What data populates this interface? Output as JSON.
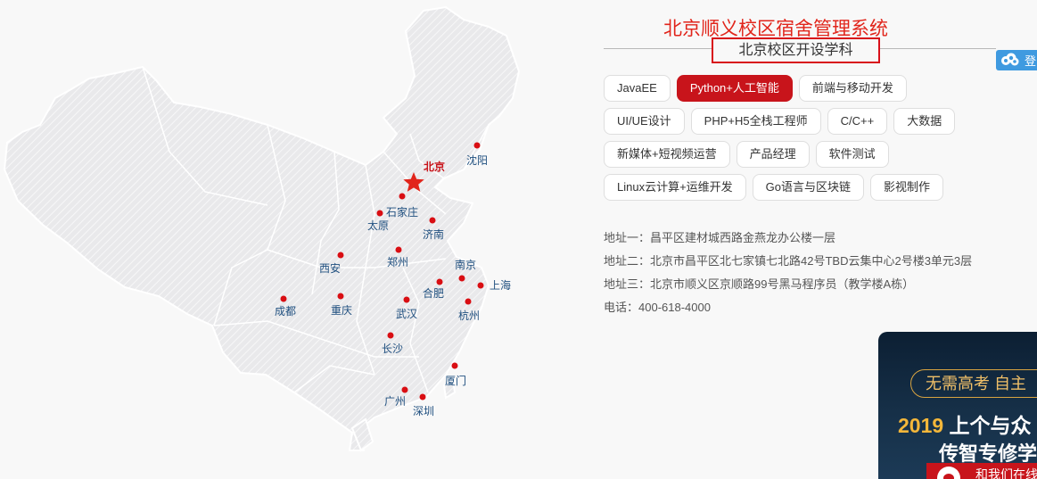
{
  "header": {
    "title": "北京顺义校区宿舍管理系统",
    "subtitle": "北京校区开设学科"
  },
  "side_widget": {
    "icon": "cloud-icon",
    "text": "登"
  },
  "subjects": {
    "rows": [
      [
        {
          "label": "JavaEE",
          "active": false
        },
        {
          "label": "Python+人工智能",
          "active": true
        },
        {
          "label": "前端与移动开发",
          "active": false
        }
      ],
      [
        {
          "label": "UI/UE设计",
          "active": false
        },
        {
          "label": "PHP+H5全栈工程师",
          "active": false
        },
        {
          "label": "C/C++",
          "active": false
        },
        {
          "label": "大数据",
          "active": false
        }
      ],
      [
        {
          "label": "新媒体+短视频运营",
          "active": false
        },
        {
          "label": "产品经理",
          "active": false
        },
        {
          "label": "软件测试",
          "active": false
        }
      ],
      [
        {
          "label": "Linux云计算+运维开发",
          "active": false
        },
        {
          "label": "Go语言与区块链",
          "active": false
        },
        {
          "label": "影视制作",
          "active": false
        }
      ]
    ]
  },
  "info": {
    "address1": "地址一：昌平区建材城西路金燕龙办公楼一层",
    "address2": "地址二：北京市昌平区北七家镇七北路42号TBD云集中心2号楼3单元3层",
    "address3": "地址三：北京市顺义区京顺路99号黑马程序员（教学楼A栋）",
    "phone": "电话：400-618-4000"
  },
  "map": {
    "cities": [
      {
        "name": "北京",
        "capital": true
      },
      {
        "name": "沈阳"
      },
      {
        "name": "石家庄"
      },
      {
        "name": "太原"
      },
      {
        "name": "济南"
      },
      {
        "name": "郑州"
      },
      {
        "name": "西安"
      },
      {
        "name": "南京"
      },
      {
        "name": "上海"
      },
      {
        "name": "合肥"
      },
      {
        "name": "杭州"
      },
      {
        "name": "成都"
      },
      {
        "name": "重庆"
      },
      {
        "name": "武汉"
      },
      {
        "name": "长沙"
      },
      {
        "name": "厦门"
      },
      {
        "name": "广州"
      },
      {
        "name": "深圳"
      }
    ]
  },
  "banner": {
    "pill": "无需高考 自主",
    "year": "2019",
    "line1_rest": " 上个与众",
    "line2": "传智专修学",
    "strip": "和我们在线"
  }
}
